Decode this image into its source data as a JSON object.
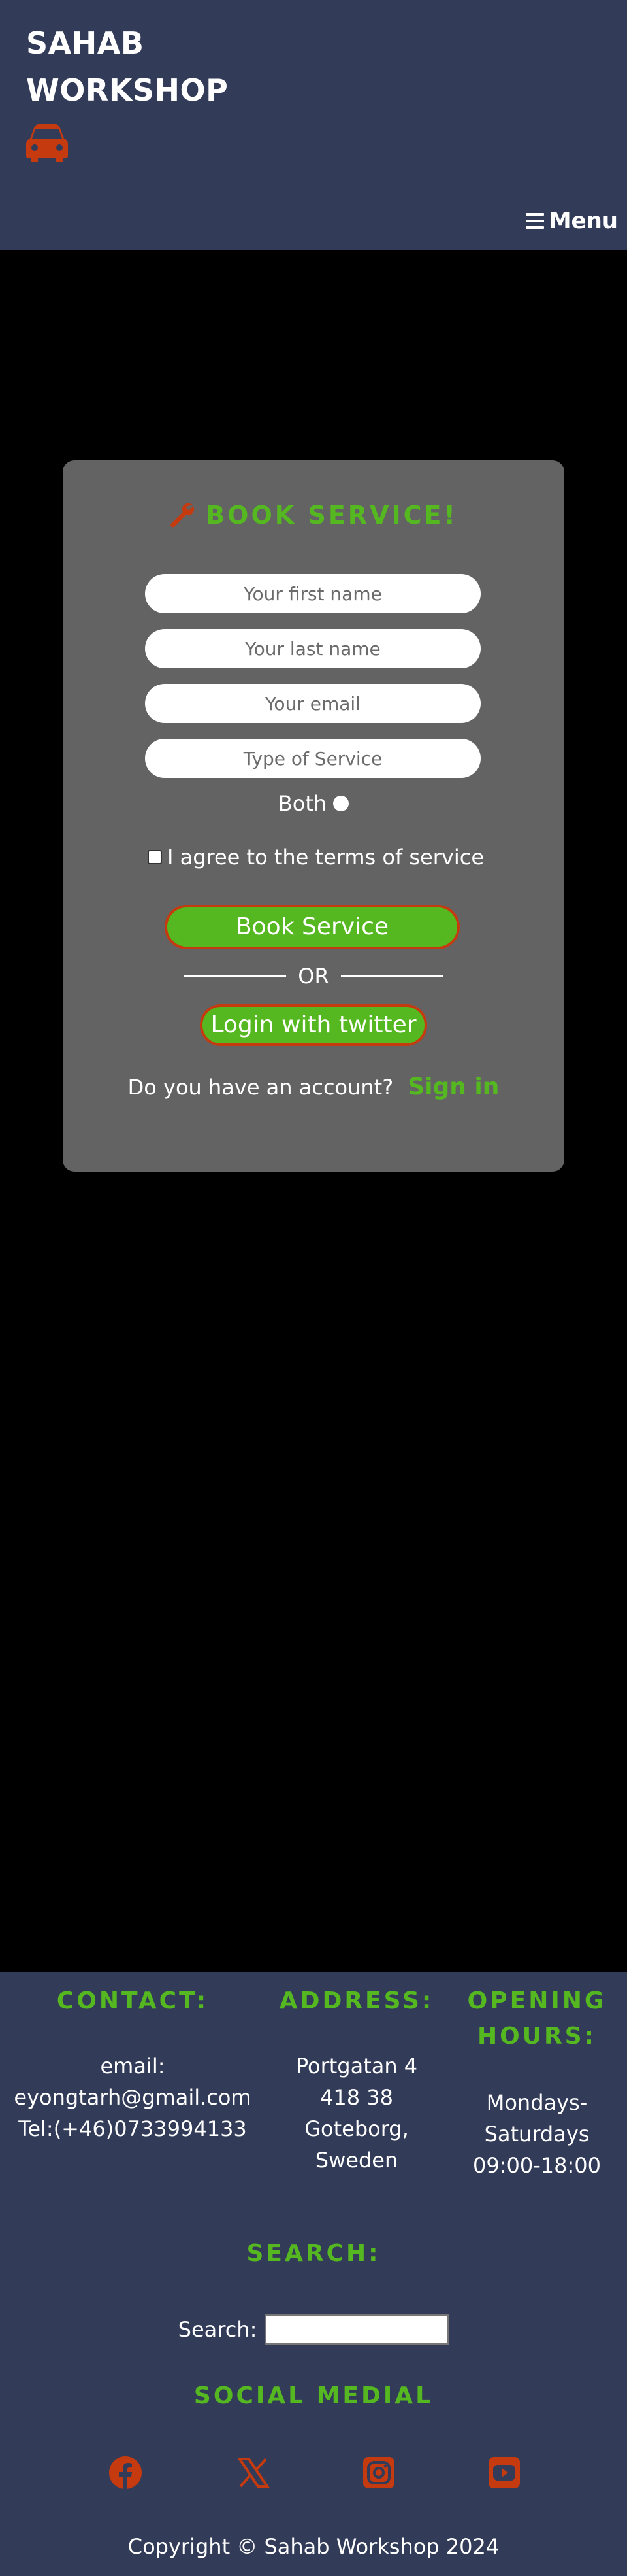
{
  "header": {
    "brand_line1": "SAHAB",
    "brand_line2": "WORKSHOP",
    "car_icon": "car-icon",
    "menu_label": "Menu",
    "menu_icon": "hamburger-icon"
  },
  "colors": {
    "header_bg": "#323b58",
    "page_bg": "#000000",
    "card_bg": "#636363",
    "accent_green": "#55b820",
    "accent_orange": "#c53a0f"
  },
  "form": {
    "title": "BOOK SERVICE!",
    "title_icon": "wrench-icon",
    "first_name_placeholder": "Your first name",
    "last_name_placeholder": "Your last name",
    "email_placeholder": "Your email",
    "service_placeholder": "Type of Service",
    "radio_label": "Both",
    "terms_label": "I agree to the terms of service",
    "book_button": "Book Service",
    "or_text": "OR",
    "twitter_button": "Login with twitter",
    "account_question": "Do you have an account?",
    "signin_link": "Sign in"
  },
  "footer": {
    "contact_heading": "CONTACT:",
    "contact_email_label": "email:",
    "contact_email": "eyongtarh@gmail.com",
    "contact_tel": "Tel:(+46)0733994133",
    "address_heading": "ADDRESS:",
    "address_line1": "Portgatan 4",
    "address_line2": "418 38",
    "address_line3": "Goteborg,",
    "address_line4": "Sweden",
    "hours_heading_line1": "OPENING",
    "hours_heading_line2": "HOURS:",
    "hours_line1": "Mondays-",
    "hours_line2": "Saturdays",
    "hours_line3": "09:00-18:00",
    "search_heading": "SEARCH:",
    "search_label": "Search:",
    "search_value": "",
    "social_heading": "SOCIAL MEDIAL",
    "social_icons": [
      "facebook-icon",
      "x-twitter-icon",
      "instagram-icon",
      "youtube-icon"
    ],
    "copyright": "Copyright © Sahab Workshop 2024"
  }
}
